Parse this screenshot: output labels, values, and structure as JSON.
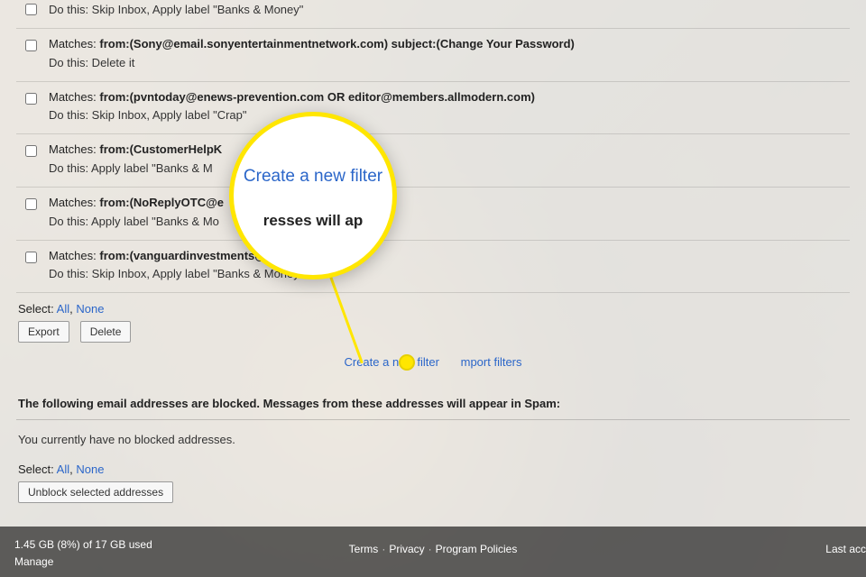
{
  "filters": [
    {
      "matches_label": "",
      "criteria": "",
      "dothis": "Do this: Skip Inbox, Apply label \"Banks & Money\""
    },
    {
      "matches_label": "Matches: ",
      "criteria": "from:(Sony@email.sonyentertainmentnetwork.com) subject:(Change Your Password)",
      "dothis": "Do this: Delete it"
    },
    {
      "matches_label": "Matches: ",
      "criteria": "from:(pvntoday@enews-prevention.com OR editor@members.allmodern.com)",
      "dothis": "Do this: Skip Inbox, Apply label \"Crap\""
    },
    {
      "matches_label": "Matches: ",
      "criteria": "from:(CustomerHelpK",
      "dothis": "Do this: Apply label \"Banks & M"
    },
    {
      "matches_label": "Matches: ",
      "criteria": "from:(NoReplyOTC@e",
      "dothis": "Do this: Apply label \"Banks & Mo"
    },
    {
      "matches_label": "Matches: ",
      "criteria": "from:(vanguardinvestments@vanguard.com)",
      "dothis": "Do this: Skip Inbox, Apply label \"Banks & Money\""
    }
  ],
  "select": {
    "label": "Select:",
    "all": "All",
    "none": "None",
    "sep": ", "
  },
  "buttons": {
    "export": "Export",
    "delete": "Delete",
    "unblock": "Unblock selected addresses"
  },
  "links": {
    "create_filter": "Create a new filter",
    "import_filters": "mport filters"
  },
  "blocked": {
    "heading": "The following email addresses are blocked. Messages from these addresses will appear in Spam:",
    "none": "You currently have no blocked addresses."
  },
  "footer": {
    "storage_line": "1.45 GB (8%) of 17 GB used",
    "manage": "Manage",
    "terms": "Terms",
    "privacy": "Privacy",
    "policies": "Program Policies",
    "right": "Last acc"
  },
  "magnifier": {
    "big": "Create a new filter",
    "sub": "resses will ap"
  }
}
